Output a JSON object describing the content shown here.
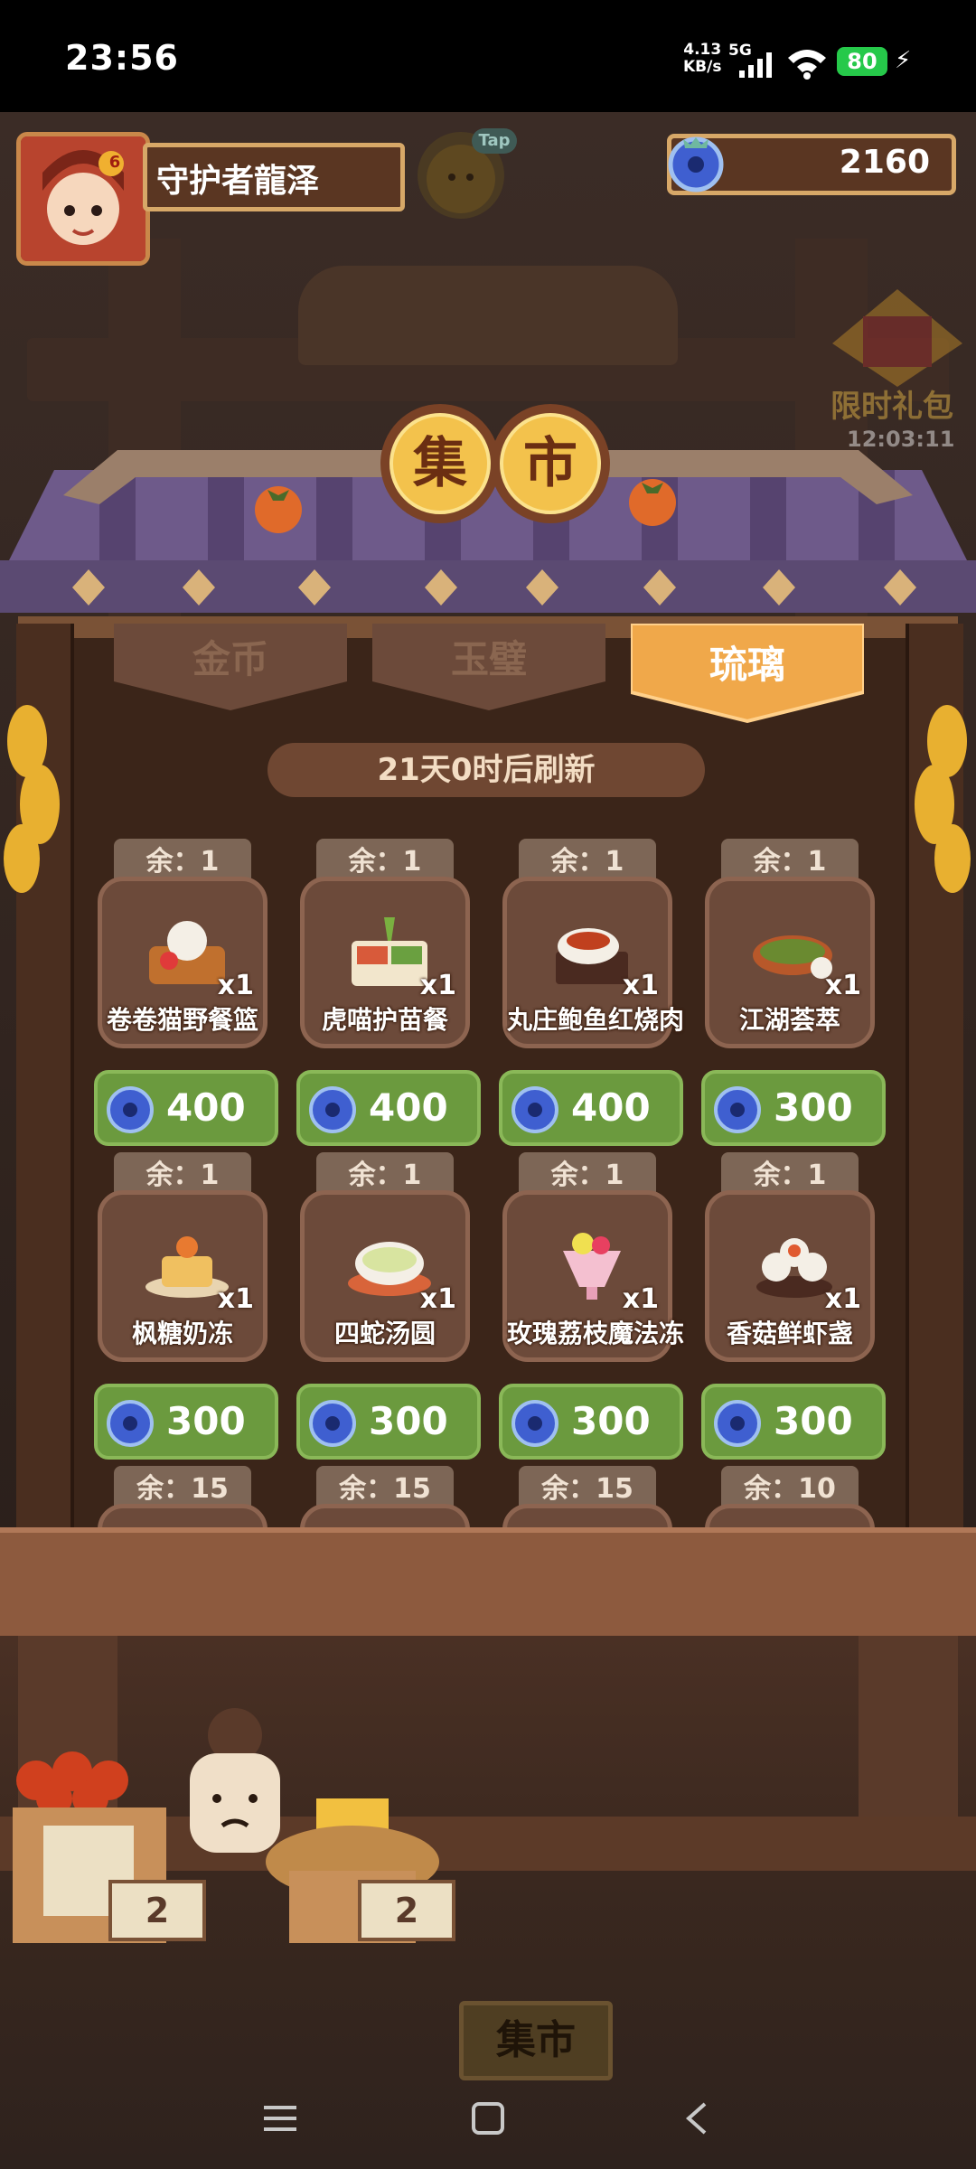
{
  "status_bar": {
    "time": "23:56",
    "net_speed": "4.13",
    "net_unit": "KB/s",
    "network": "5G",
    "battery": "80"
  },
  "player": {
    "name": "守护者龍泽",
    "level_badge": "6"
  },
  "tap_label": "Tap",
  "currency": {
    "amount": "2160",
    "icon": "glaze-gem-icon"
  },
  "limited_gift": {
    "label": "限时礼包",
    "timer": "12:03:11"
  },
  "title_chars": [
    "集",
    "市"
  ],
  "tabs": [
    {
      "label": "金币",
      "active": false
    },
    {
      "label": "玉璧",
      "active": false
    },
    {
      "label": "琉璃",
      "active": true
    }
  ],
  "refresh_text": "21天0时后刷新",
  "items": [
    {
      "remain": "余：1",
      "name": "卷卷猫野餐篮",
      "qty": "x1",
      "price": "400"
    },
    {
      "remain": "余：1",
      "name": "虎喵护苗餐",
      "qty": "x1",
      "price": "400"
    },
    {
      "remain": "余：1",
      "name": "丸庄鲍鱼红烧肉",
      "qty": "x1",
      "price": "400"
    },
    {
      "remain": "余：1",
      "name": "江湖荟萃",
      "qty": "x1",
      "price": "300"
    },
    {
      "remain": "余：1",
      "name": "枫糖奶冻",
      "qty": "x1",
      "price": "300"
    },
    {
      "remain": "余：1",
      "name": "四蛇汤圆",
      "qty": "x1",
      "price": "300"
    },
    {
      "remain": "余：1",
      "name": "玫瑰荔枝魔法冻",
      "qty": "x1",
      "price": "300"
    },
    {
      "remain": "余：1",
      "name": "香菇鲜虾盏",
      "qty": "x1",
      "price": "300"
    }
  ],
  "partial_items": [
    {
      "remain": "余：15"
    },
    {
      "remain": "余：15"
    },
    {
      "remain": "余：15"
    },
    {
      "remain": "余：10"
    }
  ],
  "crate_labels": [
    "2",
    "2"
  ],
  "market_sign": "集市",
  "colors": {
    "buy_button": "#6b9a3e",
    "active_tab": "#f0a84a",
    "gem": "#3f5fd0"
  }
}
